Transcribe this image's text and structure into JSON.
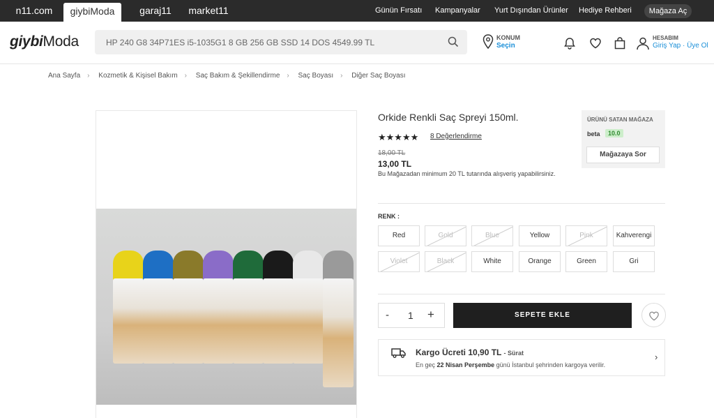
{
  "topbar": {
    "site_tabs": [
      "n11.com",
      "giybiModa",
      "garaj11",
      "market11"
    ],
    "links": [
      "Günün Fırsatı",
      "Kampanyalar",
      "Yurt Dışından Ürünler",
      "Hediye Rehberi"
    ],
    "store_open": "Mağaza Aç"
  },
  "header": {
    "logo_bold": "giybi",
    "logo_rest": "Moda",
    "search_value": "HP 240 G8 34P71ES i5-1035G1 8 GB 256 GB SSD 14 DOS 4549.99 TL",
    "location_label": "KONUM",
    "location_action": "Seçin",
    "account_label": "HESABIM",
    "account_actions": "Giriş Yap · Üye Ol"
  },
  "breadcrumb": [
    "Ana Sayfa",
    "Kozmetik & Kişisel Bakım",
    "Saç Bakım & Şekillendirme",
    "Saç Boyası",
    "Diğer Saç Boyası"
  ],
  "product": {
    "title": "Orkide Renkli Saç Spreyi 150ml.",
    "stars": "★★★★★",
    "rating_text": "8 Değerlendirme",
    "old_price": "18,00 TL",
    "price": "13,00 TL",
    "min_note": "Bu Mağazadan minimum 20 TL tutarında alışveriş yapabilirsiniz."
  },
  "seller": {
    "label": "ÜRÜNÜ SATAN MAĞAZA",
    "name": "beta",
    "score": "10.0",
    "ask": "Mağazaya Sor"
  },
  "color_label": "RENK :",
  "colors": [
    {
      "label": "Red",
      "available": true
    },
    {
      "label": "Gold",
      "available": false
    },
    {
      "label": "Blue",
      "available": false
    },
    {
      "label": "Yellow",
      "available": true
    },
    {
      "label": "Pink",
      "available": false
    },
    {
      "label": "Kahverengi",
      "available": true
    },
    {
      "label": "Violet",
      "available": false
    },
    {
      "label": "Black",
      "available": false
    },
    {
      "label": "White",
      "available": true
    },
    {
      "label": "Orange",
      "available": true
    },
    {
      "label": "Green",
      "available": true
    },
    {
      "label": "Gri",
      "available": true
    }
  ],
  "cart": {
    "minus": "-",
    "quantity": "1",
    "plus": "+",
    "add_label": "SEPETE EKLE"
  },
  "cargo": {
    "title": "Kargo Ücreti 10,90 TL",
    "speed": "- Sürat",
    "line_pre": "En geç ",
    "date": "22 Nisan Perşembe",
    "line_post": " günü İstanbul şehrinden kargoya verilir."
  },
  "can_colors": [
    "#e8d31a",
    "#1e6fc4",
    "#8a7a2a",
    "#8a6cc8",
    "#1f6b3a",
    "#1a1a1a",
    "#e8e8e8",
    "#9a9a9a"
  ]
}
